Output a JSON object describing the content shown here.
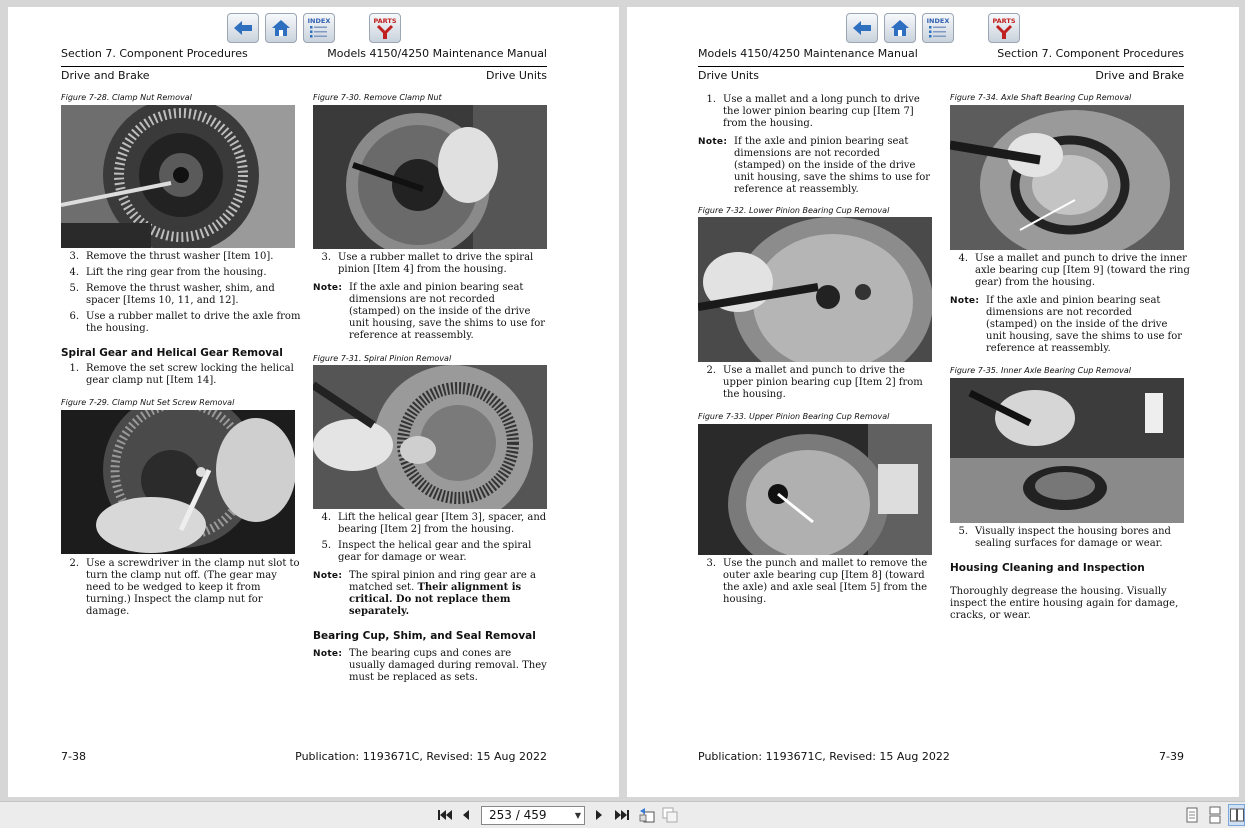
{
  "viewer": {
    "page_indicator": "253 / 459",
    "nav_icons": [
      "back-arrow-icon",
      "home-icon",
      "index-icon",
      "parts-icon"
    ],
    "index_label": "INDEX",
    "parts_label": "PARTS"
  },
  "left": {
    "header_section": "Section 7. Component Procedures",
    "header_manual": "Models 4150/4250 Maintenance Manual",
    "sub_left": "Drive and Brake",
    "sub_right": "Drive Units",
    "fig28": "Figure 7-28. Clamp Nut Removal",
    "fig29": "Figure 7-29. Clamp Nut Set Screw Removal",
    "fig30": "Figure 7-30. Remove Clamp Nut",
    "fig31": "Figure 7-31. Spiral Pinion Removal",
    "c1_steps": [
      {
        "n": "3.",
        "t": "Remove the thrust washer [Item 10]."
      },
      {
        "n": "4.",
        "t": "Lift the ring gear from the housing."
      },
      {
        "n": "5.",
        "t": "Remove the thrust washer, shim, and spacer [Items 10, 11, and 12]."
      },
      {
        "n": "6.",
        "t": "Use a rubber mallet to drive the axle from the housing."
      }
    ],
    "heading_spiral": "Spiral Gear and Helical Gear Removal",
    "step1": {
      "n": "1.",
      "t": "Remove the set screw locking the helical gear clamp nut [Item 14]."
    },
    "step2": {
      "n": "2.",
      "t": "Use a screwdriver in the clamp nut slot to turn the clamp nut off. (The gear may need to be wedged to keep it from turning.) Inspect the clamp nut for damage."
    },
    "c2_step3": {
      "n": "3.",
      "t": "Use a rubber mallet to drive the spiral pinion [Item 4] from the housing."
    },
    "note_label": "Note:",
    "note1": "If the axle and pinion bearing seat dimensions are not recorded (stamped) on the inside of the drive unit housing, save the shims to use for reference at reassembly.",
    "c2_steps45": [
      {
        "n": "4.",
        "t": "Lift the helical gear [Item 3], spacer, and bearing [Item 2] from the housing."
      },
      {
        "n": "5.",
        "t": "Inspect the helical gear and the spiral gear for damage or wear."
      }
    ],
    "note2_a": "The spiral pinion and ring gear are a matched set. ",
    "note2_b": "Their alignment is critical. Do not replace them separately.",
    "heading_bearing": "Bearing Cup, Shim, and Seal Removal",
    "note3": "The bearing cups and cones are usually damaged during removal. They must be replaced as sets.",
    "page_number": "7-38",
    "publication": "Publication: 1193671C, Revised: 15 Aug 2022"
  },
  "right": {
    "header_manual": "Models 4150/4250 Maintenance Manual",
    "header_section": "Section 7. Component Procedures",
    "sub_left": "Drive Units",
    "sub_right": "Drive and Brake",
    "c1_step1": {
      "n": "1.",
      "t": "Use a mallet and a long punch to drive the lower pinion bearing cup [Item 7] from the housing."
    },
    "note_label": "Note:",
    "note1": "If the axle and pinion bearing seat dimensions are not recorded (stamped) on the inside of the drive unit housing, save the shims to use for reference at reassembly.",
    "fig32": "Figure 7-32. Lower Pinion Bearing Cup Removal",
    "c1_step2": {
      "n": "2.",
      "t": "Use a mallet and punch to drive the upper pinion bearing cup [Item 2] from the housing."
    },
    "fig33": "Figure 7-33. Upper Pinion Bearing Cup Removal",
    "c1_step3": {
      "n": "3.",
      "t": "Use the punch and mallet to remove the outer axle bearing cup [Item 8] (toward the axle) and axle seal [Item 5] from the housing."
    },
    "fig34": "Figure 7-34. Axle Shaft Bearing Cup Removal",
    "c2_step4": {
      "n": "4.",
      "t": "Use a mallet and punch to drive the inner axle bearing cup [Item 9] (toward the ring gear) from the housing."
    },
    "note2": "If the axle and pinion bearing seat dimensions are not recorded (stamped) on the inside of the drive unit housing, save the shims to use for reference at reassembly.",
    "fig35": "Figure 7-35. Inner Axle Bearing Cup Removal",
    "c2_step5": {
      "n": "5.",
      "t": "Visually inspect the housing bores and sealing surfaces for damage or wear."
    },
    "heading_housing": "Housing Cleaning and Inspection",
    "housing_text": "Thoroughly degrease the housing. Visually inspect the entire housing again for damage, cracks, or wear.",
    "publication": "Publication: 1193671C, Revised: 15 Aug 2022",
    "page_number": "7-39"
  }
}
